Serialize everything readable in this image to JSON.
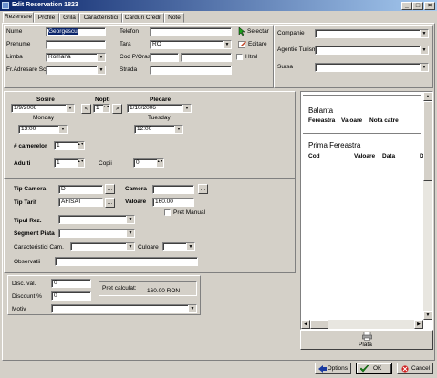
{
  "window": {
    "title": "Edit Reservation 1823",
    "min": "_",
    "max": "□",
    "close": "×"
  },
  "tabs": [
    "Rezervare",
    "Profile",
    "Grila",
    "Caracteristici",
    "Carduri Credit",
    "Note"
  ],
  "guest": {
    "nume_label": "Nume",
    "nume_value": "Georgescu",
    "prenume_label": "Prenume",
    "prenume_value": "",
    "limba_label": "Limba",
    "limba_value": "Romana",
    "adresare_label": "Fr.Adresare Sc",
    "adresare_value": "",
    "telefon_label": "Telefon",
    "telefon_value": "",
    "tara_label": "Tara",
    "tara_value": "RO",
    "codp_label": "Cod P/Oras",
    "codp_value": "",
    "oras_value": "",
    "strada_label": "Strada",
    "strada_value": "",
    "selectare_label": "Selectar",
    "editare_label": "Editare",
    "html_label": "Html"
  },
  "company": {
    "companie_label": "Companie",
    "agentie_label": "Agentie Turism",
    "sursa_label": "Sursa"
  },
  "stay": {
    "sosire_label": "Sosire",
    "sosire_date": "1/9/2006",
    "sosire_day": "Monday",
    "sosire_time": "13:00",
    "nopti_label": "Nopti",
    "nopti_value": "1",
    "prev": "<",
    "next": ">",
    "plecare_label": "Plecare",
    "plecare_date": "1/10/2006",
    "plecare_day": "Tuesday",
    "plecare_time": "12:00",
    "camere_label": "# camerelor",
    "camere_value": "1",
    "adulti_label": "Adulti",
    "adulti_value": "1",
    "copii_label": "Copii",
    "copii_value": "0"
  },
  "room": {
    "tip_camera_label": "Tip Camera",
    "tip_camera_value": "D",
    "ellipsis": "...",
    "camera_label": "Camera",
    "camera_value": "",
    "tip_tarif_label": "Tip Tarif",
    "tip_tarif_value": "AFISAT",
    "valoare_label": "Valoare",
    "valoare_value": "160.00",
    "pret_manual_label": "Pret Manual",
    "tipul_rez_label": "Tipul Rez.",
    "segment_label": "Segment Piata",
    "caract_label": "Caracteristici Cam.",
    "culoare_label": "Culoare",
    "observatii_label": "Observatii"
  },
  "discount": {
    "disc_val_label": "Disc. val.",
    "disc_val_value": "0",
    "discount_pct_label": "Discount %",
    "discount_pct_value": "0",
    "pret_calculat_label": "Pret calculat:",
    "pret_calculat_value": "160.00 RON",
    "motiv_label": "Motiv"
  },
  "balance": {
    "balanta_title": "Balanta",
    "col_fereastra": "Fereastra",
    "col_valoare": "Valoare",
    "col_nota": "Nota catre",
    "prima_title": "Prima Fereastra",
    "col_cod": "Cod",
    "col_valoare2": "Valoare",
    "col_data": "Data",
    "col_d": "D",
    "plata_label": "Plata"
  },
  "footer": {
    "options": "Options",
    "ok": "OK",
    "cancel": "Cancel"
  }
}
